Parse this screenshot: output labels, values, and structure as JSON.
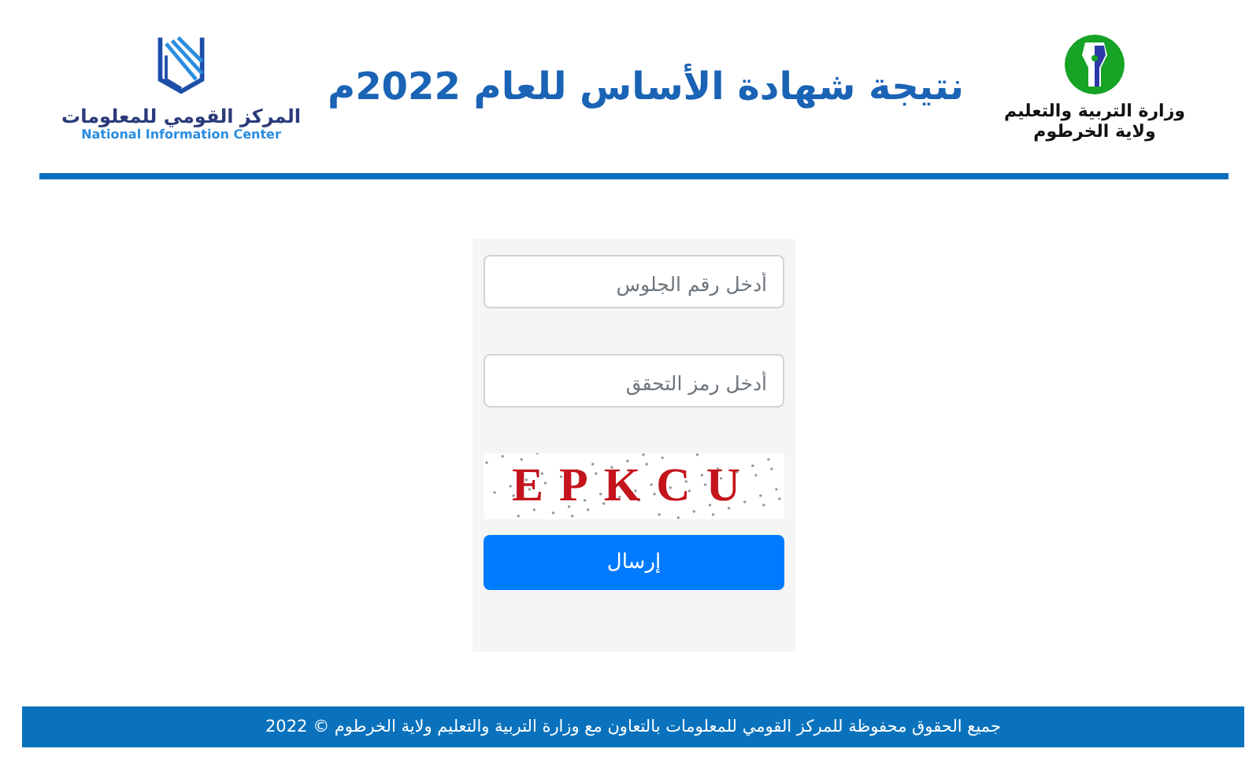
{
  "header": {
    "title": "نتيجة شهادة الأساس للعام 2022م",
    "ministry_logo": {
      "line_1": "وزارة التربية والتعليم",
      "line_2": "ولاية الخرطوم"
    },
    "center_logo": {
      "arabic": "المركز القومي للمعلومات",
      "english": "National Information Center"
    }
  },
  "form": {
    "seat_number": {
      "placeholder": "أدخل رقم الجلوس"
    },
    "verification_code": {
      "placeholder": "أدخل رمز التحقق"
    },
    "captcha": {
      "text": "EPKCU"
    },
    "submit": "إرسال"
  },
  "footer": "جميع الحقوق محفوظة للمركز القومي للمعلومات بالتعاون مع وزارة التربية والتعليم ولاية الخرطوم © 2022"
}
